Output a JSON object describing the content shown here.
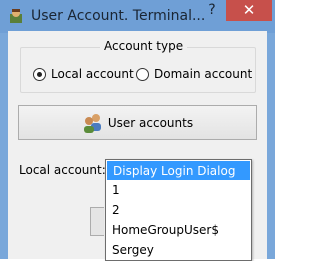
{
  "window": {
    "title": "User Account. Terminal..."
  },
  "titlebar": {
    "help_label": "?",
    "close_label": "✕"
  },
  "account_type": {
    "label": "Account type",
    "options": [
      {
        "label": "Local account",
        "selected": true
      },
      {
        "label": "Domain account",
        "selected": false
      }
    ]
  },
  "user_accounts_button": {
    "label": "User accounts"
  },
  "local_account": {
    "label": "Local account:",
    "options": [
      "Display Login Dialog",
      "1",
      "2",
      "HomeGroupUser$",
      "Sergey"
    ],
    "selected_index": 0
  },
  "colors": {
    "selection": "#3399ff",
    "close": "#c7504b",
    "frame": "#79a7da"
  },
  "icons": [
    "app-icon",
    "help-icon",
    "close-icon",
    "users-icon"
  ]
}
